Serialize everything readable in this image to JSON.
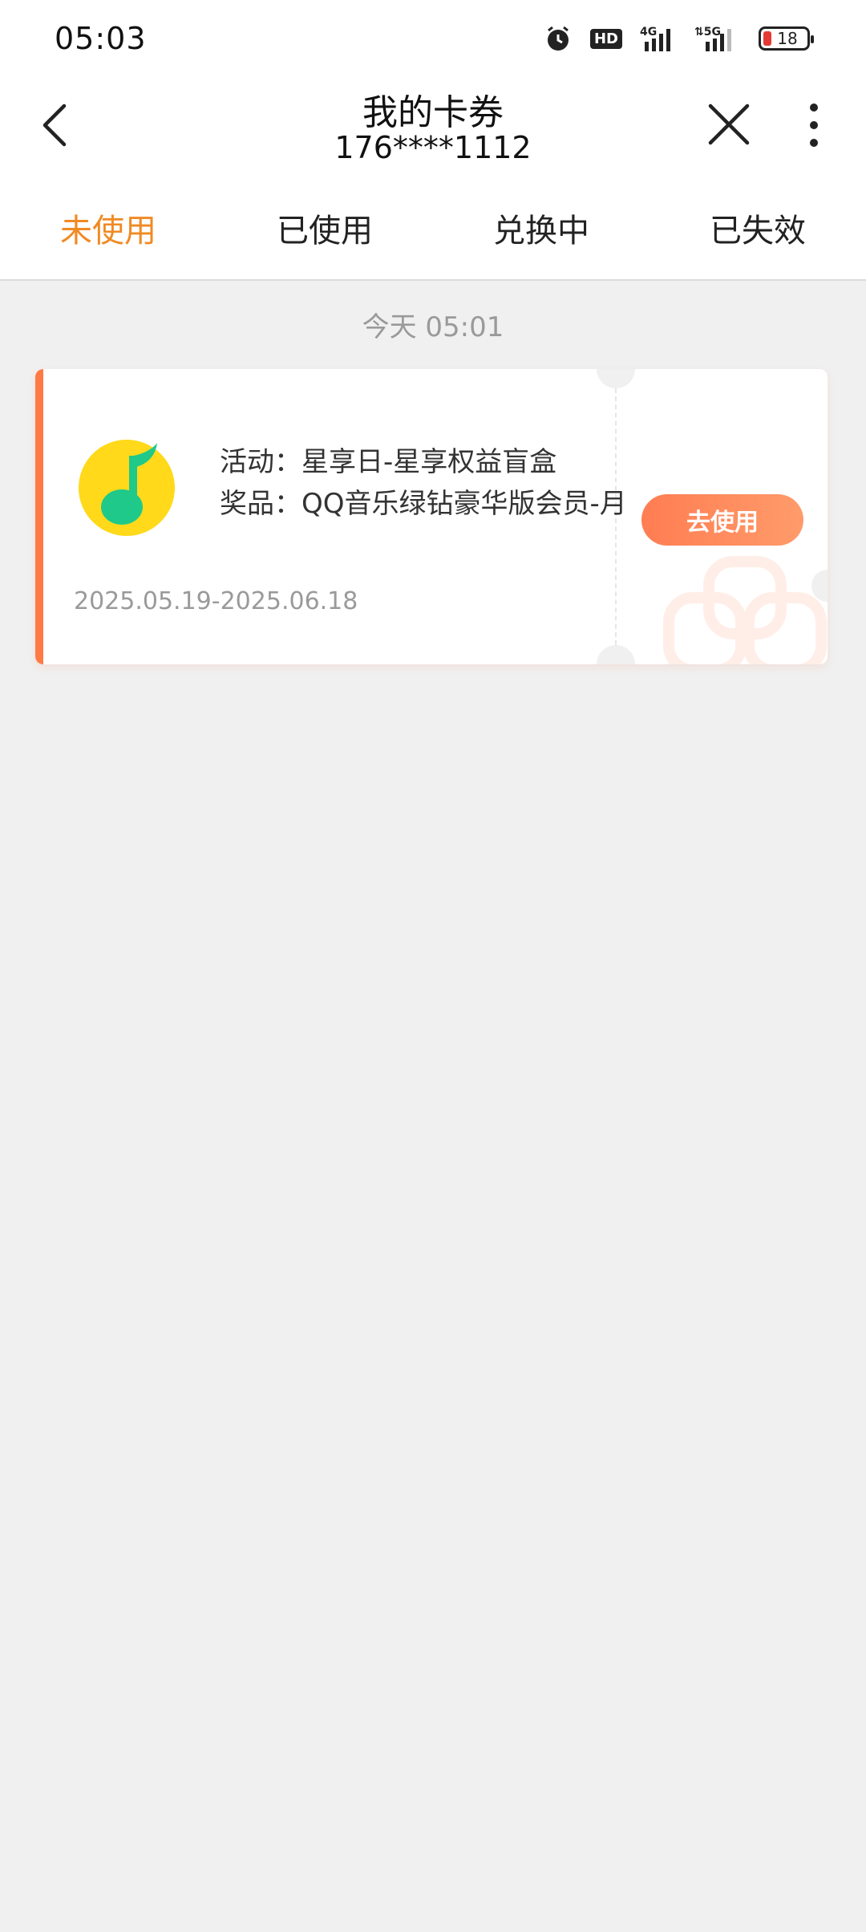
{
  "status_bar": {
    "time": "05:03",
    "icons": [
      "alarm-icon",
      "hd-icon",
      "signal-4g-icon",
      "signal-5g-icon",
      "battery-icon"
    ],
    "hd_label": "HD",
    "battery_level": "18",
    "battery_color": "#e53935"
  },
  "header": {
    "title": "我的卡券",
    "subtitle": "176****1112"
  },
  "tabs": [
    {
      "label": "未使用",
      "active": true
    },
    {
      "label": "已使用",
      "active": false
    },
    {
      "label": "兑换中",
      "active": false
    },
    {
      "label": "已失效",
      "active": false
    }
  ],
  "list": {
    "date_header": "今天 05:01",
    "coupons": [
      {
        "icon": "qq-music-icon",
        "activity": "活动：星享日-星享权益盲盒",
        "prize": "奖品：QQ音乐绿钻豪华版会员-月",
        "validity": "2025.05.19-2025.06.18",
        "action_label": "去使用"
      }
    ]
  },
  "colors": {
    "accent": "#f08a24",
    "coupon_accent": "#ff7a45",
    "background": "#f0f0f0"
  }
}
